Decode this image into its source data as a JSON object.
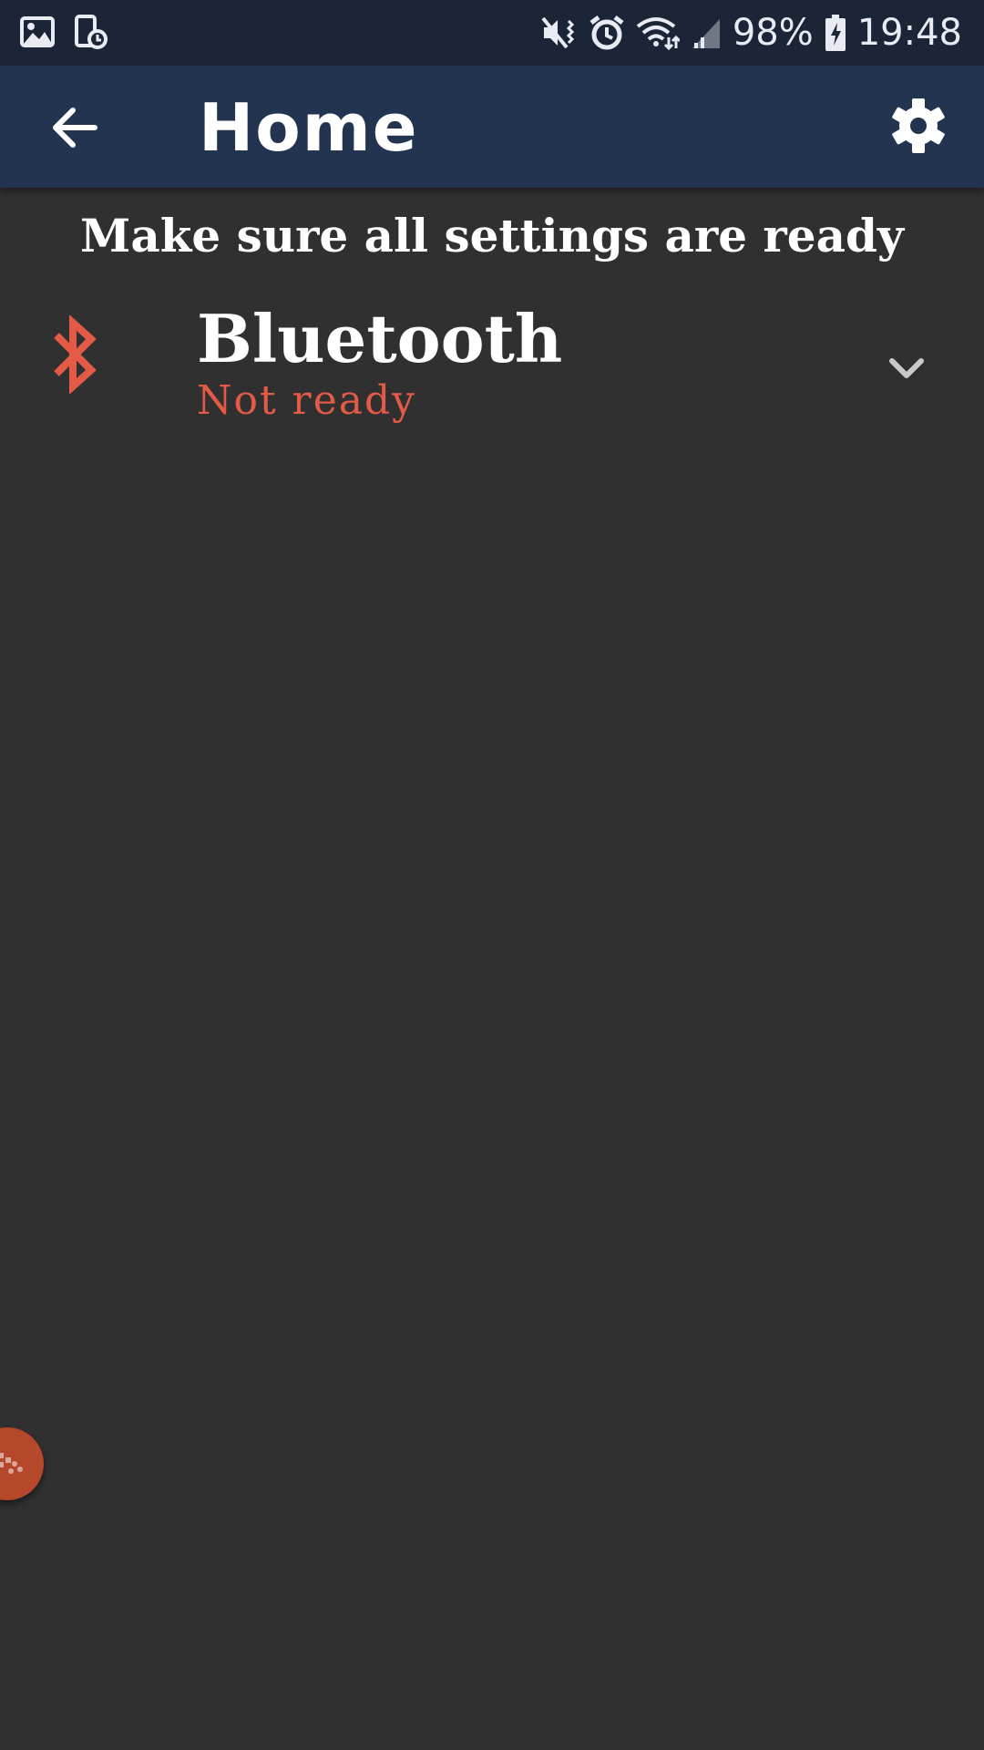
{
  "status_bar": {
    "battery": "98%",
    "time": "19:48",
    "icons": [
      "image-icon",
      "screen-timer-icon",
      "mute-vibrate-icon",
      "alarm-icon",
      "wifi-icon",
      "signal-icon",
      "battery-charging-icon"
    ]
  },
  "app_bar": {
    "title": "Home",
    "back_icon": "arrow-back-icon",
    "settings_icon": "gear-icon"
  },
  "main": {
    "instruction": "Make sure all settings are ready",
    "items": [
      {
        "title": "Bluetooth",
        "status": "Not ready",
        "icon": "bluetooth-icon",
        "expand_icon": "chevron-down-icon"
      }
    ]
  },
  "colors": {
    "status_bar_bg": "#1c2538",
    "app_bar_bg": "#22344f",
    "background": "#303030",
    "error": "#e35b46",
    "fab": "#b5472a"
  }
}
